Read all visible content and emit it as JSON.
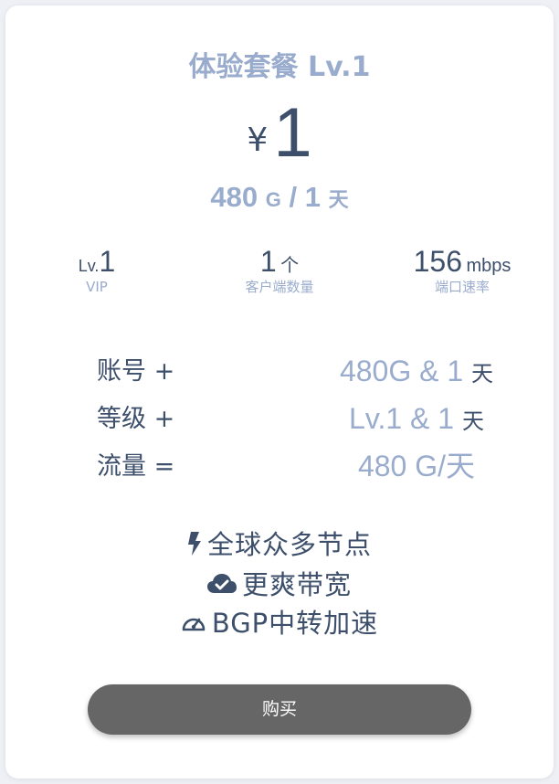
{
  "plan": {
    "title": "体验套餐 Lv.1",
    "currency": "¥",
    "price": "1",
    "quota_amount": "480",
    "quota_unit": "G",
    "quota_sep": "/",
    "quota_days": "1",
    "quota_day_unit": "天"
  },
  "stats": [
    {
      "prefix": "Lv.",
      "value": "1",
      "unit": "",
      "caption": "VIP",
      "icon": ""
    },
    {
      "prefix": "",
      "value": "1",
      "unit": "个",
      "caption": "客户端数量"
    },
    {
      "prefix": "",
      "value": "156",
      "unit": "mbps",
      "caption": "端口速率"
    }
  ],
  "rows": [
    {
      "label": "账号 +",
      "value": "480G & 1",
      "unit": "天"
    },
    {
      "label": "等级 +",
      "value": "Lv.1 & 1",
      "unit": "天"
    },
    {
      "label": "流量 =",
      "value": "480 G/",
      "unit": "天"
    }
  ],
  "features": [
    {
      "icon": "bolt-icon",
      "text": "全球众多节点"
    },
    {
      "icon": "cloud-check-icon",
      "text": "更爽带宽"
    },
    {
      "icon": "speedometer-icon",
      "text": "BGP中转加速"
    }
  ],
  "buy_button": {
    "label": "购买"
  },
  "colors": {
    "accent": "#9aaccd",
    "text": "#3d4f6b",
    "button": "#666666",
    "background": "#eef0f5"
  }
}
